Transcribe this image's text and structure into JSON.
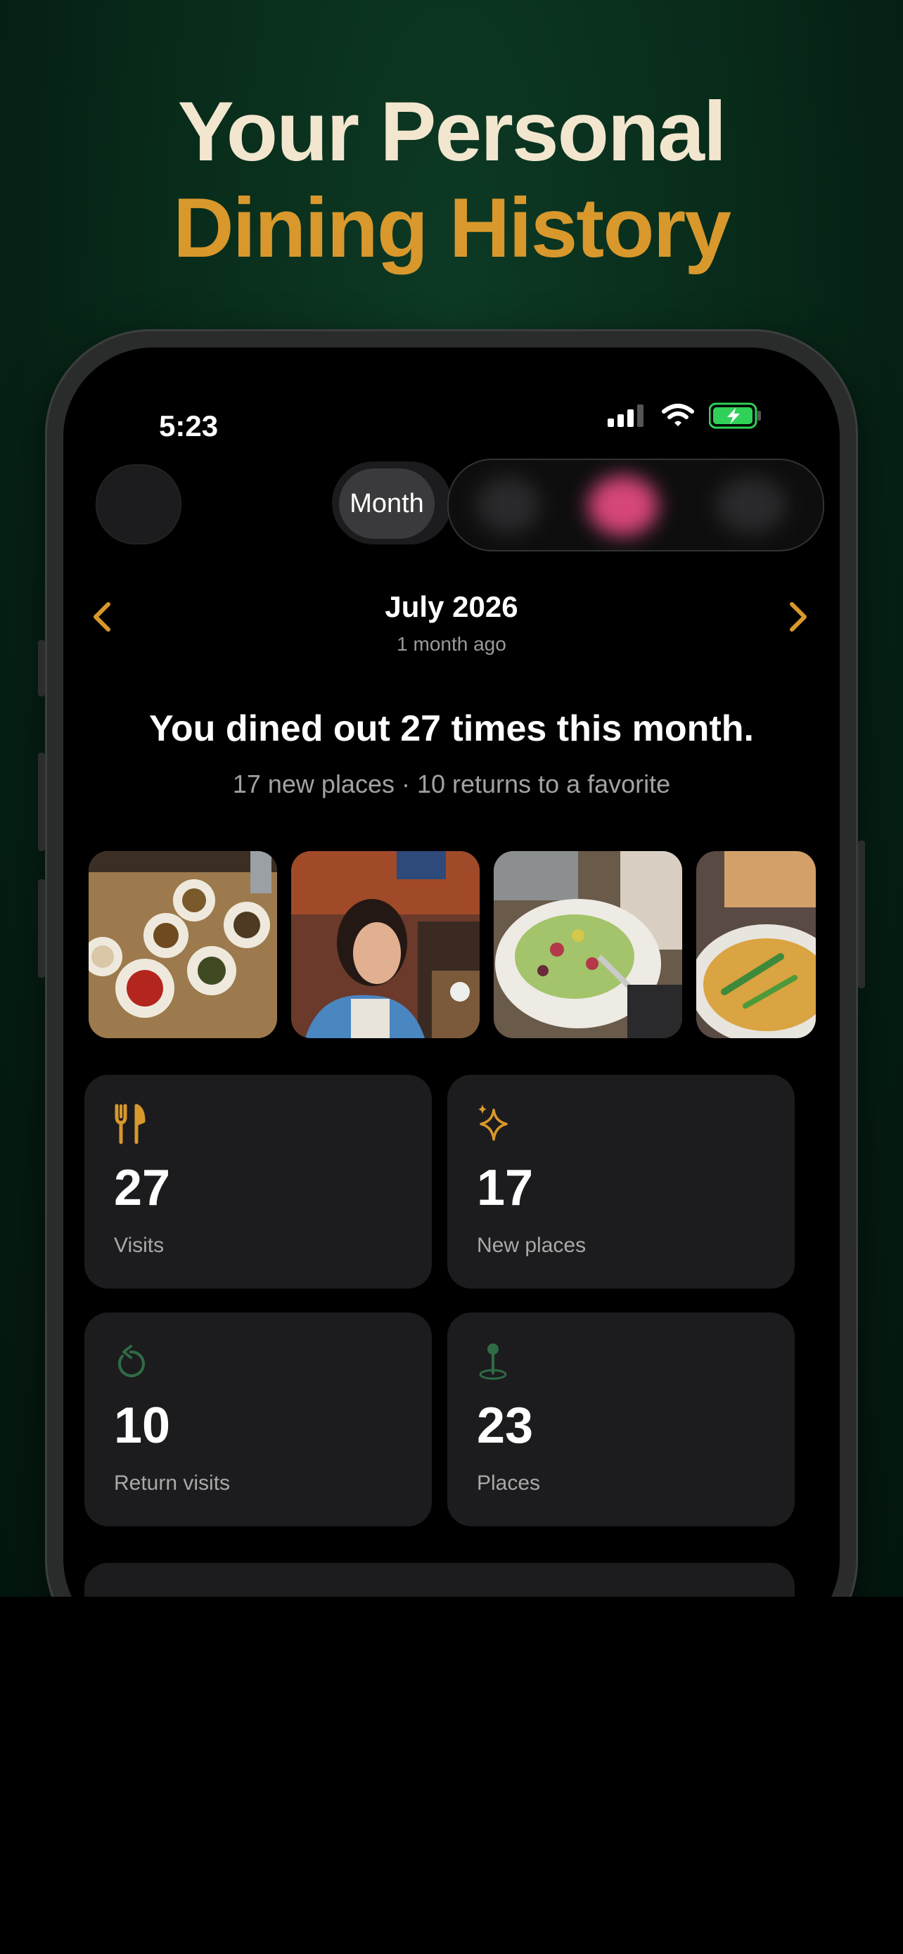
{
  "hero": {
    "headline_line1": "Your Personal",
    "headline_line2": "Dining History"
  },
  "status_bar": {
    "time": "5:23",
    "icons": [
      "signal-icon",
      "wifi-icon",
      "battery-charging-icon"
    ]
  },
  "toolbar": {
    "segment_active_label": "Month"
  },
  "period": {
    "title": "July 2026",
    "relative": "1 month ago",
    "prev_icon": "chevron-left-icon",
    "next_icon": "chevron-right-icon"
  },
  "summary": {
    "headline": "You dined out 27 times this month.",
    "subline": "17 new places · 10 returns to a favorite"
  },
  "photos": [
    {
      "name": "korean-side-dishes-photo"
    },
    {
      "name": "woman-at-restaurant-photo"
    },
    {
      "name": "salad-photo"
    },
    {
      "name": "curry-dish-photo"
    }
  ],
  "stats": [
    {
      "icon": "fork-knife-icon",
      "value": "27",
      "label": "Visits",
      "color": "#d9982c"
    },
    {
      "icon": "sparkles-icon",
      "value": "17",
      "label": "New places",
      "color": "#d9982c"
    },
    {
      "icon": "return-arrow-icon",
      "value": "10",
      "label": "Return visits",
      "color": "#2f6b45"
    },
    {
      "icon": "map-pin-icon",
      "value": "23",
      "label": "Places",
      "color": "#2f6b45"
    }
  ],
  "colors": {
    "accent": "#d9982c",
    "headline_light": "#f2e6cf",
    "background_green": "#0b3320",
    "card": "#1c1c1e"
  }
}
